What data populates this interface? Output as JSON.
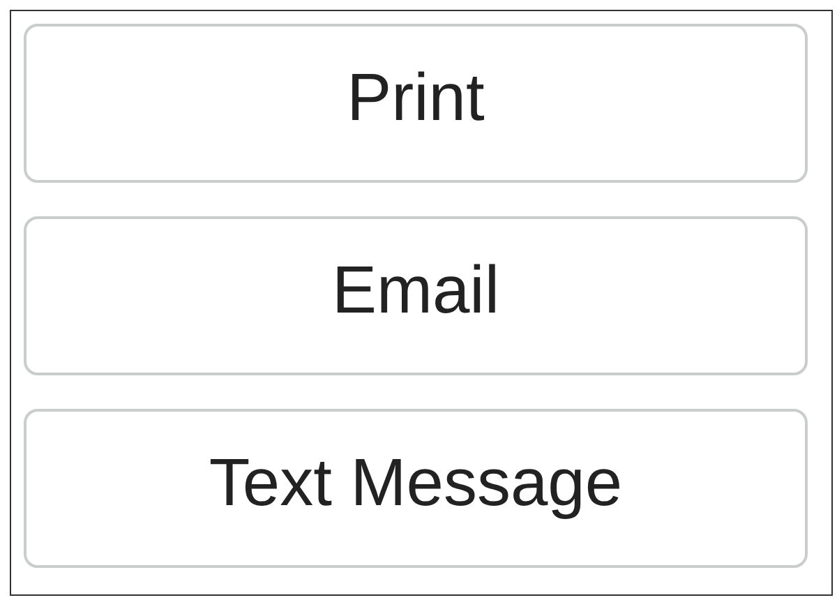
{
  "buttons": [
    {
      "label": "Print"
    },
    {
      "label": "Email"
    },
    {
      "label": "Text Message"
    }
  ]
}
